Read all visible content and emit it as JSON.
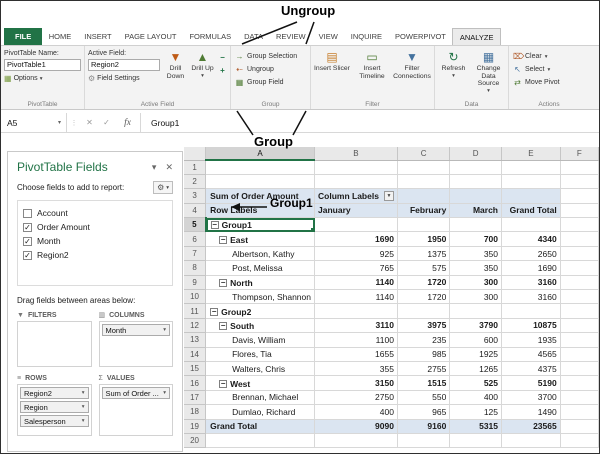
{
  "annotations": {
    "ungroup": "Ungroup",
    "group": "Group",
    "group1": "Group1"
  },
  "tabs": {
    "items": [
      {
        "label": "FILE",
        "file": true
      },
      {
        "label": "HOME"
      },
      {
        "label": "INSERT"
      },
      {
        "label": "PAGE LAYOUT"
      },
      {
        "label": "FORMULAS"
      },
      {
        "label": "DATA"
      },
      {
        "label": "REVIEW"
      },
      {
        "label": "VIEW"
      },
      {
        "label": "INQUIRE"
      },
      {
        "label": "POWERPIVOT"
      },
      {
        "label": "ANALYZE",
        "active": true
      }
    ]
  },
  "ribbon": {
    "pivottable": {
      "caption": "PivotTable",
      "name_label": "PivotTable Name:",
      "name_value": "PivotTable1",
      "options": "Options"
    },
    "active_field": {
      "caption": "Active Field",
      "label": "Active Field:",
      "value": "Region2",
      "field_settings": "Field Settings",
      "drill_down": "Drill Down",
      "drill_up": "Drill Up"
    },
    "group": {
      "caption": "Group",
      "items": [
        {
          "label": "Group Selection",
          "icon": "group-selection-icon"
        },
        {
          "label": "Ungroup",
          "icon": "ungroup-icon"
        },
        {
          "label": "Group Field",
          "icon": "group-field-icon"
        }
      ]
    },
    "filter": {
      "caption": "Filter",
      "items": [
        {
          "label": "Insert Slicer",
          "icon": "slicer-icon"
        },
        {
          "label": "Insert Timeline",
          "icon": "timeline-icon"
        },
        {
          "label": "Filter Connections",
          "icon": "filter-connections-icon"
        }
      ]
    },
    "data": {
      "caption": "Data",
      "items": [
        {
          "label": "Refresh",
          "icon": "refresh-icon",
          "caret": true
        },
        {
          "label": "Change Data Source",
          "icon": "change-data-source-icon",
          "caret": true
        }
      ]
    },
    "actions": {
      "caption": "Actions",
      "items": [
        {
          "label": "Clear",
          "icon": "clear-icon",
          "caret": true
        },
        {
          "label": "Select",
          "icon": "select-icon",
          "caret": true
        },
        {
          "label": "Move Pivot",
          "icon": "move-pivot-icon"
        }
      ]
    }
  },
  "formula_bar": {
    "name_box": "A5",
    "content": "Group1"
  },
  "fields_pane": {
    "title": "PivotTable Fields",
    "choose_label": "Choose fields to add to report:",
    "fields": [
      {
        "name": "Account",
        "checked": false
      },
      {
        "name": "Order Amount",
        "checked": true
      },
      {
        "name": "Month",
        "checked": true
      },
      {
        "name": "Region2",
        "checked": true
      }
    ],
    "drag_label": "Drag fields between areas below:",
    "areas": {
      "filters": {
        "label": "FILTERS",
        "icon": "filters-area-icon",
        "items": []
      },
      "columns": {
        "label": "COLUMNS",
        "icon": "columns-area-icon",
        "items": [
          "Month"
        ]
      },
      "rows": {
        "label": "ROWS",
        "icon": "rows-area-icon",
        "items": [
          "Region2",
          "Region",
          "Salesperson"
        ]
      },
      "values": {
        "label": "VALUES",
        "icon": "values-area-icon",
        "items": [
          "Sum of Order ..."
        ]
      }
    }
  },
  "grid": {
    "columns": [
      "A",
      "B",
      "C",
      "D",
      "E",
      "F"
    ],
    "selected_col": "A",
    "selected_cell": "A5",
    "rows": [
      {
        "n": 1
      },
      {
        "n": 2
      },
      {
        "n": 3,
        "head": true,
        "bold": true,
        "a": "Sum of Order Amount",
        "vals": [
          "Column Labels",
          "",
          "",
          ""
        ],
        "align": [
          "l",
          "l",
          "l",
          "l"
        ],
        "filter_b": true
      },
      {
        "n": 4,
        "head": true,
        "bold": true,
        "a": "Row Labels",
        "vals": [
          "January",
          "February",
          "March",
          "Grand Total"
        ],
        "align": [
          "l",
          "r",
          "r",
          "r"
        ]
      },
      {
        "n": 5,
        "a": "Group1",
        "lvl": 0,
        "exp": true,
        "bold": true,
        "sel": true
      },
      {
        "n": 6,
        "a": "East",
        "lvl": 1,
        "exp": true,
        "bold": true,
        "vals": [
          "1690",
          "1950",
          "700",
          "4340"
        ]
      },
      {
        "n": 7,
        "a": "Albertson, Kathy",
        "lvl": 2,
        "vals": [
          "925",
          "1375",
          "350",
          "2650"
        ]
      },
      {
        "n": 8,
        "a": "Post, Melissa",
        "lvl": 2,
        "vals": [
          "765",
          "575",
          "350",
          "1690"
        ]
      },
      {
        "n": 9,
        "a": "North",
        "lvl": 1,
        "exp": true,
        "bold": true,
        "vals": [
          "1140",
          "1720",
          "300",
          "3160"
        ]
      },
      {
        "n": 10,
        "a": "Thompson, Shannon",
        "lvl": 2,
        "vals": [
          "1140",
          "1720",
          "300",
          "3160"
        ]
      },
      {
        "n": 11,
        "a": "Group2",
        "lvl": 0,
        "exp": true,
        "bold": true
      },
      {
        "n": 12,
        "a": "South",
        "lvl": 1,
        "exp": true,
        "bold": true,
        "vals": [
          "3110",
          "3975",
          "3790",
          "10875"
        ]
      },
      {
        "n": 13,
        "a": "Davis, William",
        "lvl": 2,
        "vals": [
          "1100",
          "235",
          "600",
          "1935"
        ]
      },
      {
        "n": 14,
        "a": "Flores, Tia",
        "lvl": 2,
        "vals": [
          "1655",
          "985",
          "1925",
          "4565"
        ]
      },
      {
        "n": 15,
        "a": "Walters, Chris",
        "lvl": 2,
        "vals": [
          "355",
          "2755",
          "1265",
          "4375"
        ]
      },
      {
        "n": 16,
        "a": "West",
        "lvl": 1,
        "exp": true,
        "bold": true,
        "vals": [
          "3150",
          "1515",
          "525",
          "5190"
        ]
      },
      {
        "n": 17,
        "a": "Brennan, Michael",
        "lvl": 2,
        "vals": [
          "2750",
          "550",
          "400",
          "3700"
        ]
      },
      {
        "n": 18,
        "a": "Dumlao, Richard",
        "lvl": 2,
        "vals": [
          "400",
          "965",
          "125",
          "1490"
        ]
      },
      {
        "n": 19,
        "a": "Grand Total",
        "head": true,
        "bold": true,
        "vals": [
          "9090",
          "9160",
          "5315",
          "23565"
        ]
      },
      {
        "n": 20
      }
    ]
  },
  "icons": {
    "options-icon": "▦",
    "field-settings-icon": "⚙",
    "drill-down-icon": "▼",
    "drill-up-icon": "▲",
    "collapse-field-icon": "−",
    "expand-field-icon": "+",
    "group-selection-icon": "→",
    "ungroup-icon": "⇠",
    "group-field-icon": "▦",
    "slicer-icon": "▤",
    "timeline-icon": "▭",
    "filter-connections-icon": "▼",
    "refresh-icon": "↻",
    "change-data-source-icon": "▦",
    "clear-icon": "⌦",
    "select-icon": "↖",
    "move-pivot-icon": "⇄",
    "name-box-caret-icon": "▾",
    "formula-splitter-icon": "⋮",
    "cancel-icon": "✕",
    "enter-icon": "✓",
    "fx-icon": "fx",
    "pane-options-icon": "▾",
    "pane-close-icon": "✕",
    "gear-icon": "⚙",
    "filters-area-icon": "▼",
    "columns-area-icon": "▥",
    "rows-area-icon": "≡",
    "values-area-icon": "Σ",
    "dropdown-caret-icon": "▾",
    "column-labels-filter-icon": "▼",
    "collapse-outline-icon": "−",
    "check-icon": "✓"
  },
  "colors": {
    "accent_green": "#217346",
    "pivot_header_blue": "#dbe5f1",
    "selection_green": "#217346"
  }
}
